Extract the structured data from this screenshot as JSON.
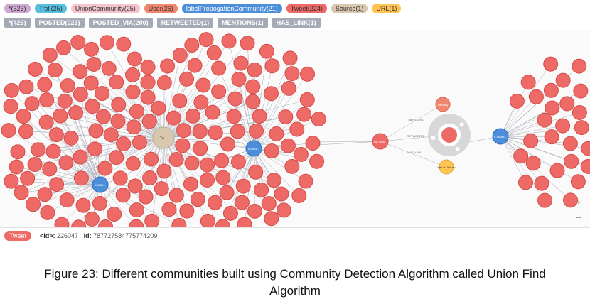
{
  "toolbar": {
    "labels": [
      {
        "text": "*(323)",
        "color": "#cfa9d3"
      },
      {
        "text": "Troll(25)",
        "color": "#56c0e1"
      },
      {
        "text": "UnionCommunity(25)",
        "color": "#f5c5cf"
      },
      {
        "text": "User(26)",
        "color": "#f0866e"
      },
      {
        "text": "labelPropogationCommunity(21)",
        "color": "#4c8eda"
      },
      {
        "text": "Tweet(224)",
        "color": "#ed6a67"
      },
      {
        "text": "Source(1)",
        "color": "#d9c8ae"
      },
      {
        "text": "URL(1)",
        "color": "#ffc454"
      }
    ],
    "relationships": [
      {
        "text": "*(426)"
      },
      {
        "text": "POSTED(223)"
      },
      {
        "text": "POSTED_VIA(200)"
      },
      {
        "text": "RETWEETED(1)"
      },
      {
        "text": "MENTIONS(1)"
      },
      {
        "text": "HAS_LINK(1)"
      }
    ]
  },
  "graph": {
    "colors": {
      "tweet": "#ed6a67",
      "tweet_stroke": "#d34b48",
      "source": "#d9c8ae",
      "community": "#4c8eda",
      "user": "#f0866e",
      "url": "#ffc454",
      "edge": "#a5abb6"
    },
    "hub_label": "Tw...",
    "community_labels": [
      "tl.9586...",
      "tl.9584...",
      "tl.18688..."
    ],
    "center_tweet_label": "1477606...",
    "user_label": "4rtthrtuy",
    "url_label": "http://u.link.eu",
    "edge_labels": [
      "MENTIONS",
      "RETWEETED",
      "HAS_LINK"
    ]
  },
  "statusbar": {
    "label": "Tweet",
    "id_key": "<id>:",
    "id_value": "226047",
    "id2_key": "id:",
    "id2_value": "787727584775774209"
  },
  "zoom": {
    "in": "+",
    "out": "−"
  },
  "caption": {
    "line1": "Figure 23: Different communities built using Community Detection Algorithm called Union Find",
    "line2": "Algorithm"
  }
}
